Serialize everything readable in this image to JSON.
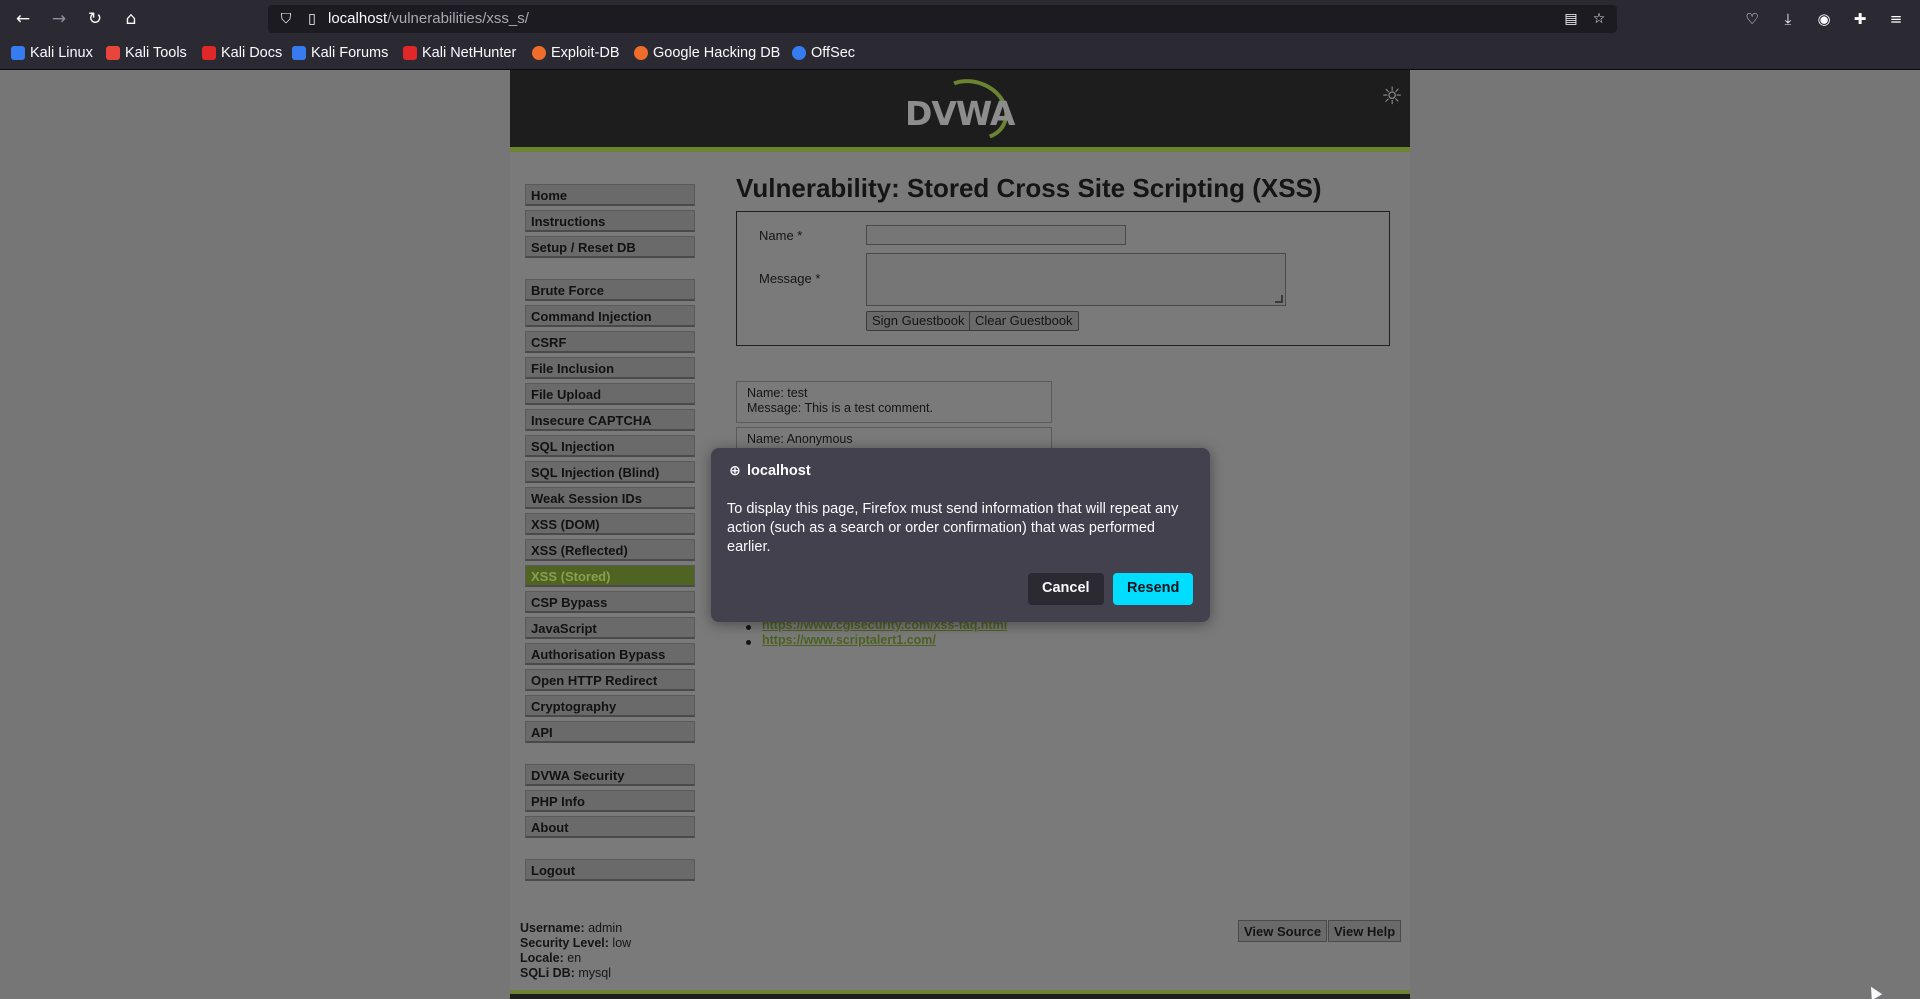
{
  "browser": {
    "url_host": "localhost",
    "url_path": "/vulnerabilities/xss_s/",
    "bookmarks": [
      {
        "label": "Kali Linux",
        "icon": "kali-dragon-icon",
        "color": "#367bf0"
      },
      {
        "label": "Kali Tools",
        "icon": "kali-tools-icon",
        "color": "#e8453c"
      },
      {
        "label": "Kali Docs",
        "icon": "kali-docs-icon",
        "color": "#e02828"
      },
      {
        "label": "Kali Forums",
        "icon": "kali-forums-icon",
        "color": "#367bf0"
      },
      {
        "label": "Kali NetHunter",
        "icon": "kali-nethunter-icon",
        "color": "#e02828"
      },
      {
        "label": "Exploit-DB",
        "icon": "exploit-db-icon",
        "color": "#f06c2b"
      },
      {
        "label": "Google Hacking DB",
        "icon": "google-hacking-db-icon",
        "color": "#f06c2b"
      },
      {
        "label": "OffSec",
        "icon": "offsec-icon",
        "color": "#367bf0"
      }
    ]
  },
  "dvwa": {
    "logo_text": "DVWA",
    "menu": {
      "group1": [
        "Home",
        "Instructions",
        "Setup / Reset DB"
      ],
      "group2": [
        "Brute Force",
        "Command Injection",
        "CSRF",
        "File Inclusion",
        "File Upload",
        "Insecure CAPTCHA",
        "SQL Injection",
        "SQL Injection (Blind)",
        "Weak Session IDs",
        "XSS (DOM)",
        "XSS (Reflected)",
        "XSS (Stored)",
        "CSP Bypass",
        "JavaScript",
        "Authorisation Bypass",
        "Open HTTP Redirect",
        "Cryptography",
        "API"
      ],
      "group3": [
        "DVWA Security",
        "PHP Info",
        "About"
      ],
      "logout": "Logout",
      "active": "XSS (Stored)"
    },
    "page_title": "Vulnerability: Stored Cross Site Scripting (XSS)",
    "form": {
      "name_label": "Name *",
      "name_value": "",
      "message_label": "Message *",
      "message_value": "",
      "sign_button": "Sign Guestbook",
      "clear_button": "Clear Guestbook"
    },
    "entries": [
      {
        "name": "Name: test",
        "message": "Message: This is a test comment."
      },
      {
        "name": "Name: Anonymous",
        "message": ""
      }
    ],
    "links": [
      "https://www.cgisecurity.com/xss-faq.html",
      "https://www.scriptalert1.com/"
    ],
    "footer": {
      "username_label": "Username:",
      "username": "admin",
      "security_label": "Security Level:",
      "security": "low",
      "locale_label": "Locale:",
      "locale": "en",
      "sqli_label": "SQLi DB:",
      "sqli": "mysql",
      "view_source": "View Source",
      "view_help": "View Help"
    }
  },
  "dialog": {
    "title": "localhost",
    "message": "To display this page, Firefox must send information that will repeat any action (such as a search or order confirmation) that was performed earlier.",
    "cancel": "Cancel",
    "resend": "Resend"
  }
}
